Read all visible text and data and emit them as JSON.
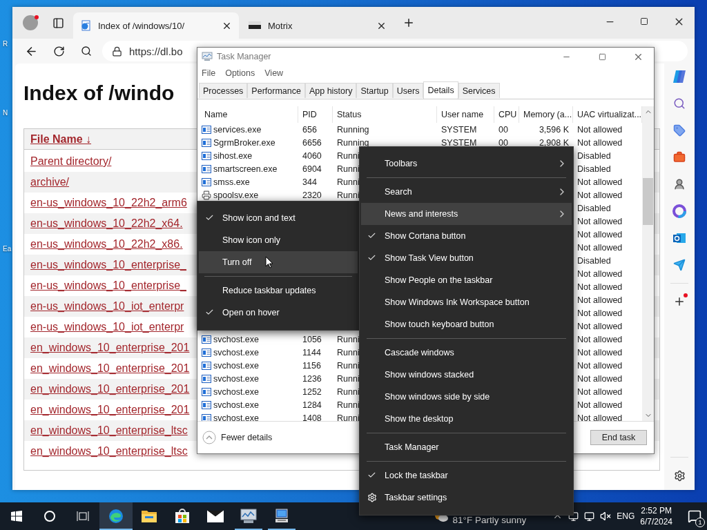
{
  "desktop_icons": [
    {
      "label": "R"
    },
    {
      "label": "N"
    },
    {
      "label": "Ea"
    }
  ],
  "browser": {
    "tabs": [
      {
        "title": "Index of /windows/10/",
        "selected": true,
        "kind": "page"
      },
      {
        "title": "Motrix",
        "selected": false,
        "kind": "app"
      }
    ],
    "address": "https://dl.bo",
    "page": {
      "heading": "Index of /windo",
      "column_header": "File Name  ↓",
      "links": [
        "Parent directory/",
        "archive/",
        "en-us_windows_10_22h2_arm6",
        "en-us_windows_10_22h2_x64.",
        "en-us_windows_10_22h2_x86.",
        "en-us_windows_10_enterprise_",
        "en-us_windows_10_enterprise_",
        "en-us_windows_10_iot_enterpr",
        "en-us_windows_10_iot_enterpr",
        "en_windows_10_enterprise_201",
        "en_windows_10_enterprise_201",
        "en_windows_10_enterprise_201",
        "en_windows_10_enterprise_201",
        "en_windows_10_enterprise_ltsc",
        "en_windows_10_enterprise_ltsc"
      ]
    }
  },
  "task_manager": {
    "title": "Task Manager",
    "menu": [
      "File",
      "Options",
      "View"
    ],
    "tabs": [
      {
        "label": "Processes",
        "selected": false
      },
      {
        "label": "Performance",
        "selected": false
      },
      {
        "label": "App history",
        "selected": false
      },
      {
        "label": "Startup",
        "selected": false
      },
      {
        "label": "Users",
        "selected": false
      },
      {
        "label": "Details",
        "selected": true
      },
      {
        "label": "Services",
        "selected": false
      }
    ],
    "columns": [
      "Name",
      "PID",
      "Status",
      "User name",
      "CPU",
      "Memory (a...",
      "UAC virtualizat..."
    ],
    "rows": [
      {
        "name": "services.exe",
        "pid": "656",
        "status": "Running",
        "user": "SYSTEM",
        "cpu": "00",
        "memory": "3,596 K",
        "uac": "Not allowed",
        "kind": "app"
      },
      {
        "name": "SgrmBroker.exe",
        "pid": "6656",
        "status": "Running",
        "user": "SYSTEM",
        "cpu": "00",
        "memory": "2,908 K",
        "uac": "Not allowed",
        "kind": "app"
      },
      {
        "name": "sihost.exe",
        "pid": "4060",
        "status": "Runni",
        "uac": "Disabled",
        "kind": "app"
      },
      {
        "name": "smartscreen.exe",
        "pid": "6904",
        "status": "Runni",
        "uac": "Disabled",
        "kind": "app"
      },
      {
        "name": "smss.exe",
        "pid": "344",
        "status": "Runni",
        "uac": "Not allowed",
        "kind": "app"
      },
      {
        "name": "spoolsv.exe",
        "pid": "2320",
        "status": "Runni",
        "uac": "Not allowed",
        "kind": "printer"
      },
      {
        "uac": "Disabled"
      },
      {
        "uac": "Not allowed"
      },
      {
        "uac": "Not allowed"
      },
      {
        "uac": "Not allowed"
      },
      {
        "uac": "Disabled"
      },
      {
        "uac": "Not allowed"
      },
      {
        "uac": "Not allowed"
      },
      {
        "uac": "Not allowed"
      },
      {
        "uac": "Not allowed"
      },
      {
        "uac": "Not allowed"
      },
      {
        "name": "svchost.exe",
        "pid": "1056",
        "status": "Runni",
        "uac": "Not allowed",
        "kind": "app"
      },
      {
        "name": "svchost.exe",
        "pid": "1144",
        "status": "Runni",
        "uac": "Not allowed",
        "kind": "app"
      },
      {
        "name": "svchost.exe",
        "pid": "1156",
        "status": "Runni",
        "uac": "Not allowed",
        "kind": "app"
      },
      {
        "name": "svchost.exe",
        "pid": "1236",
        "status": "Runni",
        "uac": "Not allowed",
        "kind": "app"
      },
      {
        "name": "svchost.exe",
        "pid": "1252",
        "status": "Runni",
        "uac": "Not allowed",
        "kind": "app"
      },
      {
        "name": "svchost.exe",
        "pid": "1284",
        "status": "Runni",
        "uac": "Not allowed",
        "kind": "app"
      },
      {
        "name": "svchost.exe",
        "pid": "1408",
        "status": "Runni",
        "uac": "Not allowed",
        "kind": "app"
      }
    ],
    "fewer_details": "Fewer details",
    "end_task": "End task"
  },
  "submenu": [
    {
      "kind": "command",
      "label": "Show icon and text",
      "checked": true,
      "highlighted": false
    },
    {
      "kind": "command",
      "label": "Show icon only",
      "checked": false,
      "highlighted": false
    },
    {
      "kind": "command",
      "label": "Turn off",
      "checked": false,
      "highlighted": true
    },
    {
      "kind": "separator"
    },
    {
      "kind": "command",
      "label": "Reduce taskbar updates",
      "checked": false,
      "highlighted": false
    },
    {
      "kind": "command",
      "label": "Open on hover",
      "checked": true,
      "highlighted": false
    }
  ],
  "context_menu": [
    {
      "kind": "submenu",
      "label": "Toolbars",
      "checked": false,
      "highlighted": false
    },
    {
      "kind": "separator"
    },
    {
      "kind": "submenu",
      "label": "Search",
      "checked": false,
      "highlighted": false
    },
    {
      "kind": "submenu",
      "label": "News and interests",
      "checked": false,
      "highlighted": true
    },
    {
      "kind": "command",
      "label": "Show Cortana button",
      "checked": true,
      "highlighted": false
    },
    {
      "kind": "command",
      "label": "Show Task View button",
      "checked": true,
      "highlighted": false
    },
    {
      "kind": "command",
      "label": "Show People on the taskbar",
      "checked": false,
      "highlighted": false
    },
    {
      "kind": "command",
      "label": "Show Windows Ink Workspace button",
      "checked": false,
      "highlighted": false
    },
    {
      "kind": "command",
      "label": "Show touch keyboard button",
      "checked": false,
      "highlighted": false
    },
    {
      "kind": "separator"
    },
    {
      "kind": "command",
      "label": "Cascade windows",
      "checked": false,
      "highlighted": false
    },
    {
      "kind": "command",
      "label": "Show windows stacked",
      "checked": false,
      "highlighted": false
    },
    {
      "kind": "command",
      "label": "Show windows side by side",
      "checked": false,
      "highlighted": false
    },
    {
      "kind": "command",
      "label": "Show the desktop",
      "checked": false,
      "highlighted": false
    },
    {
      "kind": "separator"
    },
    {
      "kind": "command",
      "label": "Task Manager",
      "checked": false,
      "highlighted": false
    },
    {
      "kind": "separator"
    },
    {
      "kind": "command",
      "label": "Lock the taskbar",
      "checked": true,
      "highlighted": false
    },
    {
      "kind": "settings",
      "label": "Taskbar settings",
      "checked": false,
      "highlighted": false
    }
  ],
  "taskbar": {
    "apps": [
      {
        "kind": "edge",
        "selected": true,
        "running": true
      },
      {
        "kind": "explorer",
        "selected": false,
        "running": false
      },
      {
        "kind": "store",
        "selected": false,
        "running": false
      },
      {
        "kind": "mail",
        "selected": false,
        "running": false
      },
      {
        "kind": "taskmgr",
        "selected": false,
        "running": true
      },
      {
        "kind": "remote",
        "selected": false,
        "running": true
      }
    ],
    "weather": "81°F  Partly sunny",
    "language": "ENG",
    "time": "2:52 PM",
    "date": "6/7/2024",
    "notifications": "1"
  }
}
